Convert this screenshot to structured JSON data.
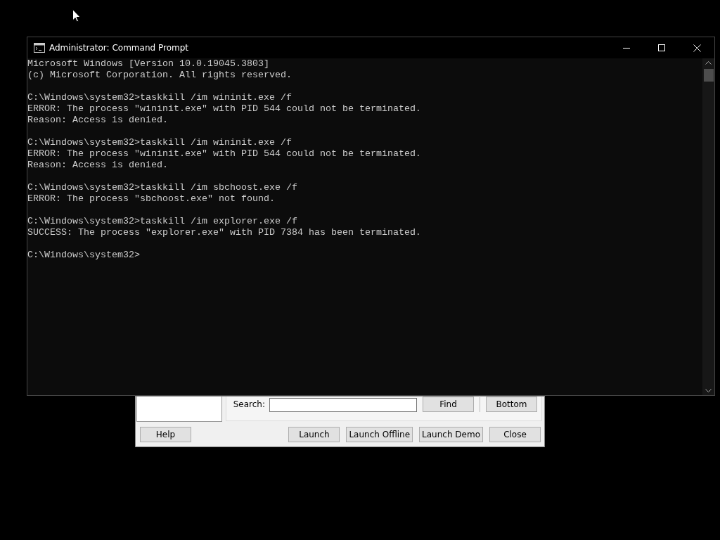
{
  "console_window": {
    "title": "Administrator: Command Prompt",
    "blocks": [
      {
        "lines": [
          "Microsoft Windows [Version 10.0.19045.3803]",
          "(c) Microsoft Corporation. All rights reserved."
        ]
      },
      {
        "lines": [
          "C:\\Windows\\system32>taskkill /im wininit.exe /f",
          "ERROR: The process \"wininit.exe\" with PID 544 could not be terminated.",
          "Reason: Access is denied."
        ]
      },
      {
        "lines": [
          "C:\\Windows\\system32>taskkill /im wininit.exe /f",
          "ERROR: The process \"wininit.exe\" with PID 544 could not be terminated.",
          "Reason: Access is denied."
        ]
      },
      {
        "lines": [
          "C:\\Windows\\system32>taskkill /im sbchoost.exe /f",
          "ERROR: The process \"sbchoost.exe\" not found."
        ]
      },
      {
        "lines": [
          "C:\\Windows\\system32>taskkill /im explorer.exe /f",
          "SUCCESS: The process \"explorer.exe\" with PID 7384 has been terminated."
        ]
      },
      {
        "lines": [
          "C:\\Windows\\system32>"
        ]
      }
    ]
  },
  "launcher_window": {
    "search_label": "Search:",
    "search_buttons": [
      "Find",
      "Bottom"
    ],
    "left_buttons": [
      "Help"
    ],
    "right_buttons": [
      "Launch",
      "Launch Offline",
      "Launch Demo",
      "Close"
    ]
  }
}
